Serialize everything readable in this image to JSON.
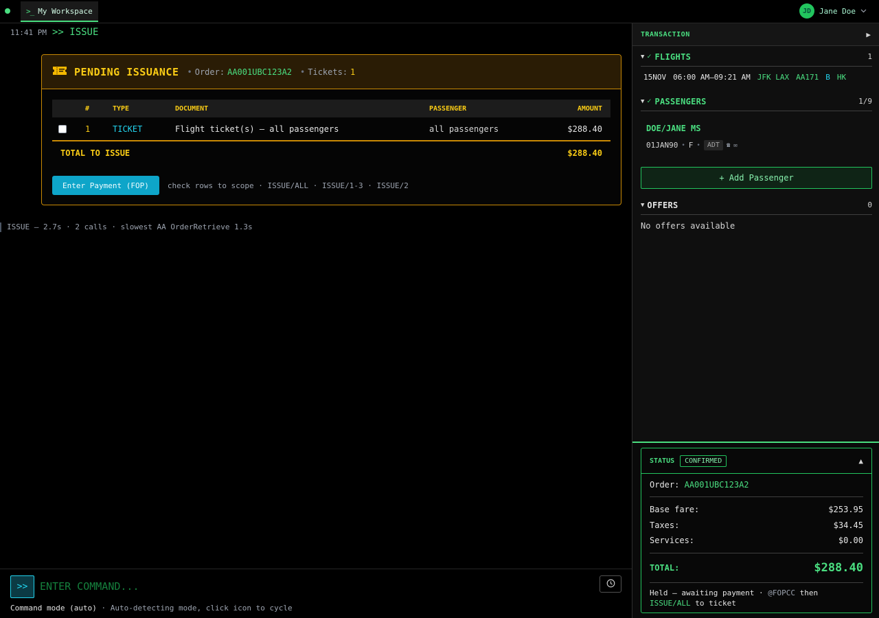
{
  "topbar": {
    "workspace_tab": "My Workspace",
    "user_initials": "JD",
    "user_name": "Jane Doe"
  },
  "echo": {
    "time": "11:41 PM",
    "command": ">> ISSUE"
  },
  "issuance": {
    "title": "PENDING ISSUANCE",
    "order_label": "Order:",
    "order_value": "AA001UBC123A2",
    "tickets_label": "Tickets:",
    "tickets_value": "1",
    "columns": [
      "#",
      "TYPE",
      "DOCUMENT",
      "PASSENGER",
      "AMOUNT"
    ],
    "rows": [
      {
        "num": "1",
        "type": "TICKET",
        "document": "Flight ticket(s) — all passengers",
        "passenger": "all passengers",
        "amount": "$288.40"
      }
    ],
    "total_label": "TOTAL TO ISSUE",
    "total_value": "$288.40",
    "pay_button": "Enter Payment (FOP)",
    "hint": "check rows to scope · ISSUE/ALL · ISSUE/1-3 · ISSUE/2"
  },
  "perf_line": "ISSUE — 2.7s · 2 calls · slowest AA OrderRetrieve 1.3s",
  "command_bar": {
    "prompt": ">>",
    "placeholder": "ENTER COMMAND...",
    "mode": "Command mode (auto)",
    "mode_hint": "· Auto-detecting mode, click icon to cycle"
  },
  "panel": {
    "title": "TRANSACTION",
    "flights": {
      "label": "FLIGHTS",
      "count": "1",
      "segment": {
        "date": "15NOV",
        "time": "06:00 AM–09:21 AM",
        "route": "JFK LAX",
        "flight": "AA171",
        "class": "B",
        "status": "HK"
      }
    },
    "passengers": {
      "label": "PASSENGERS",
      "count": "1/9",
      "name": "DOE/JANE MS",
      "dob": "01JAN90",
      "gender": "F",
      "ptc": "ADT",
      "add_button": "+ Add Passenger"
    },
    "offers": {
      "label": "OFFERS",
      "count": "0",
      "empty": "No offers available"
    },
    "status": {
      "label": "STATUS",
      "badge": "CONFIRMED",
      "order_label": "Order:",
      "order_value": "AA001UBC123A2",
      "base_label": "Base fare:",
      "base_value": "$253.95",
      "taxes_label": "Taxes:",
      "taxes_value": "$34.45",
      "services_label": "Services:",
      "services_value": "$0.00",
      "total_label": "TOTAL:",
      "total_value": "$288.40",
      "held_text": "Held — awaiting payment ·",
      "held_cmd": "@FOPCC",
      "held_then": "then",
      "held_issue": "ISSUE/ALL",
      "held_end": "to ticket"
    }
  },
  "colors": {
    "accent_green": "#4ade80",
    "accent_yellow": "#facc15",
    "accent_cyan": "#22d3ee",
    "card_border": "#ca8a04"
  }
}
